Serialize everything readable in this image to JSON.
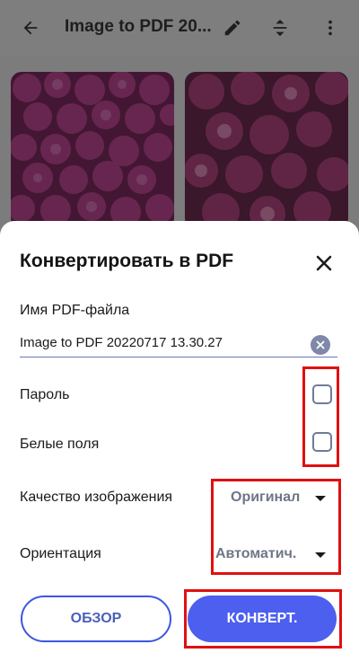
{
  "appbar": {
    "title": "Image to PDF 20...",
    "icons": [
      "back-arrow-icon",
      "pencil-icon",
      "sort-icon",
      "more-vert-icon"
    ]
  },
  "gallery": {
    "images": [
      "pink-peonies-image",
      "pink-peonies-image"
    ]
  },
  "dialog": {
    "title": "Конвертировать в PDF",
    "filename_label": "Имя PDF-файла",
    "filename_value": "Image to PDF 20220717 13.30.27",
    "password_label": "Пароль",
    "password_checked": false,
    "margins_label": "Белые поля",
    "margins_checked": false,
    "quality_label": "Качество изображения",
    "quality_value": "Оригинал",
    "orientation_label": "Ориентация",
    "orientation_value": "Автоматич.",
    "browse_button": "ОБЗОР",
    "convert_button": "КОНВЕРТ."
  },
  "colors": {
    "accent": "#4c5fee",
    "highlight": "#e01010",
    "overlay": "#7c7c7c"
  }
}
